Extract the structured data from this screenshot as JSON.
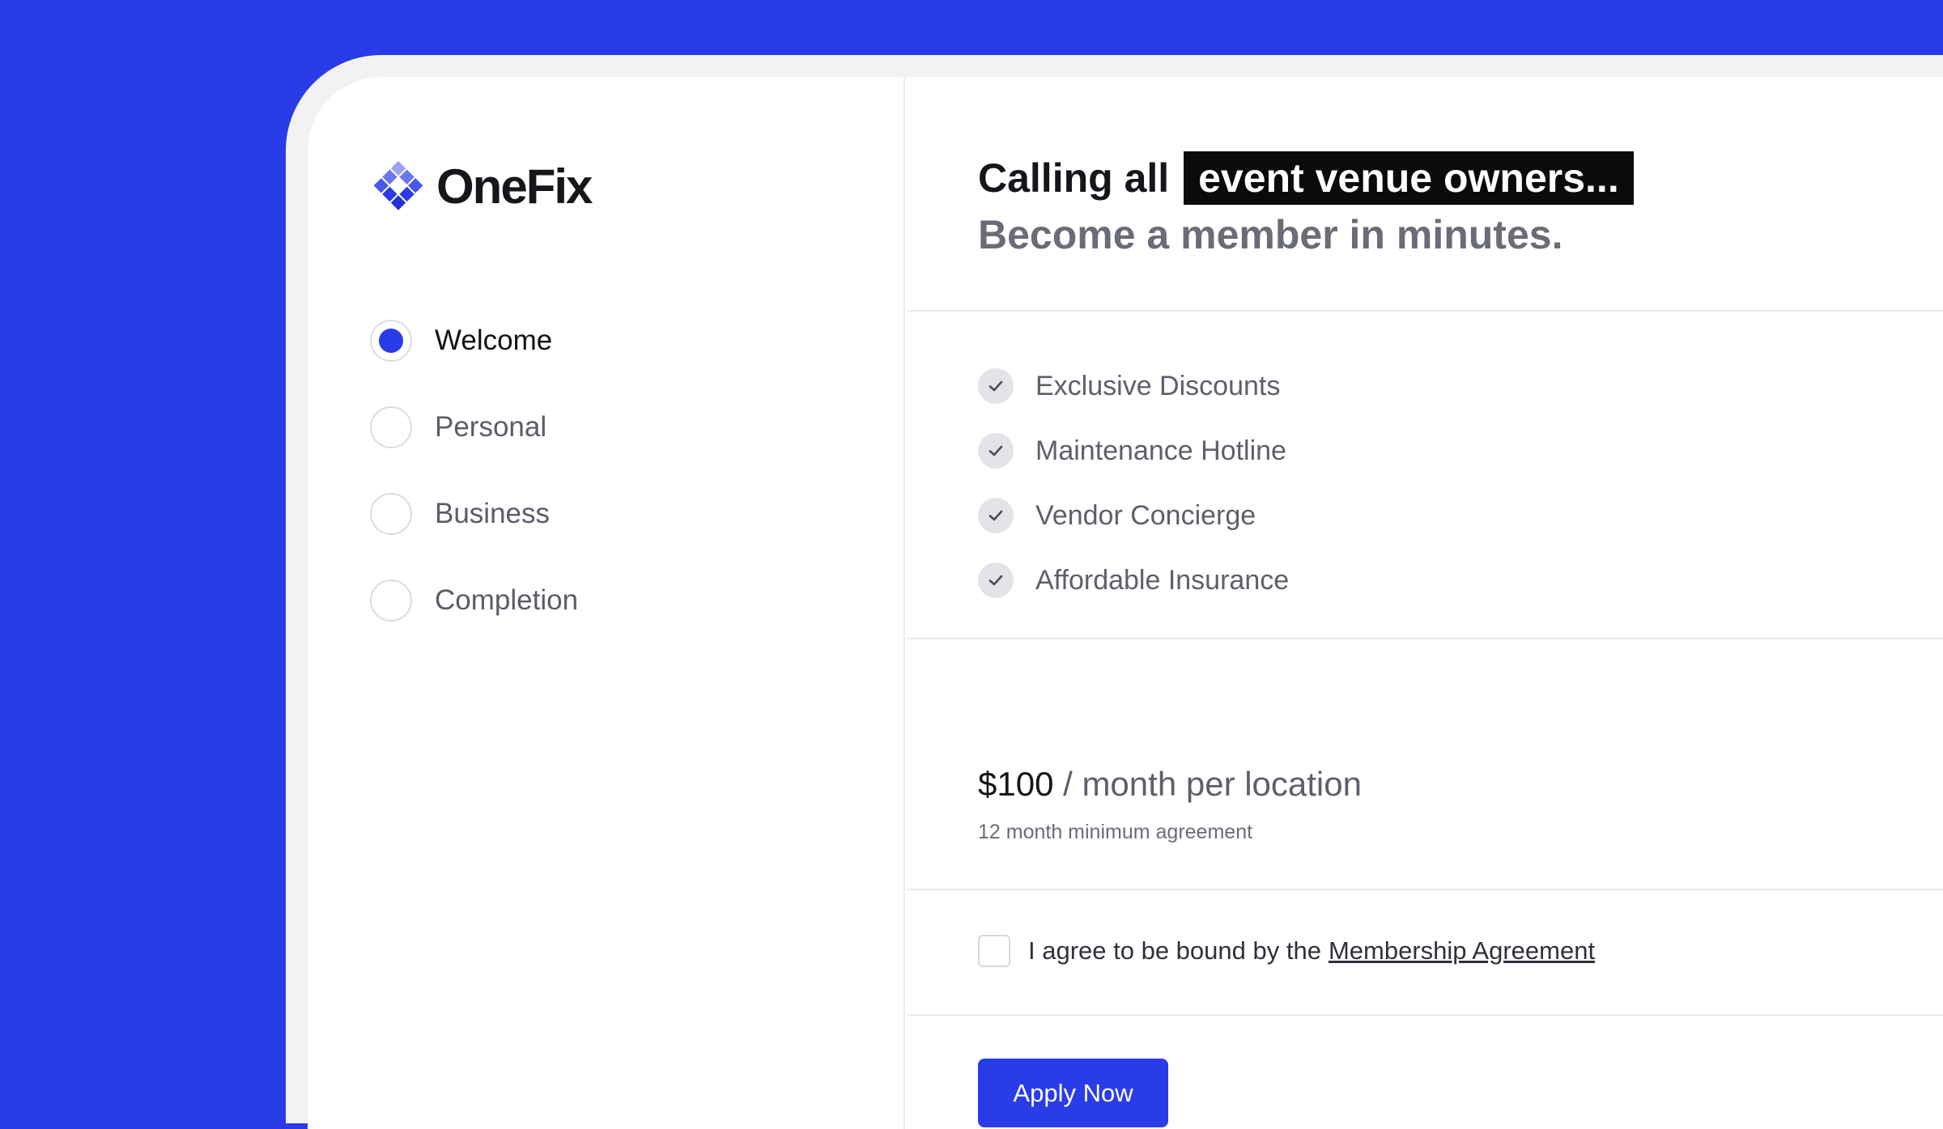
{
  "brand": {
    "name": "OneFix",
    "accent_color": "#2a3be8",
    "logo_icon": "diamond-grid-icon"
  },
  "steps": [
    {
      "label": "Welcome",
      "active": true
    },
    {
      "label": "Personal",
      "active": false
    },
    {
      "label": "Business",
      "active": false
    },
    {
      "label": "Completion",
      "active": false
    }
  ],
  "hero": {
    "headline_prefix": "Calling all",
    "headline_highlight": "event venue owners...",
    "subheadline": "Become a member in minutes."
  },
  "features": [
    {
      "label": "Exclusive Discounts",
      "icon": "check-icon"
    },
    {
      "label": "Maintenance Hotline",
      "icon": "check-icon"
    },
    {
      "label": "Vendor Concierge",
      "icon": "check-icon"
    },
    {
      "label": "Affordable Insurance",
      "icon": "check-icon"
    }
  ],
  "pricing": {
    "amount": "$100",
    "period": "/ month per location",
    "note": "12 month minimum agreement"
  },
  "agreement": {
    "checked": false,
    "text": "I agree to be bound by the",
    "link_text": "Membership Agreement"
  },
  "cta": {
    "label": "Apply Now"
  }
}
